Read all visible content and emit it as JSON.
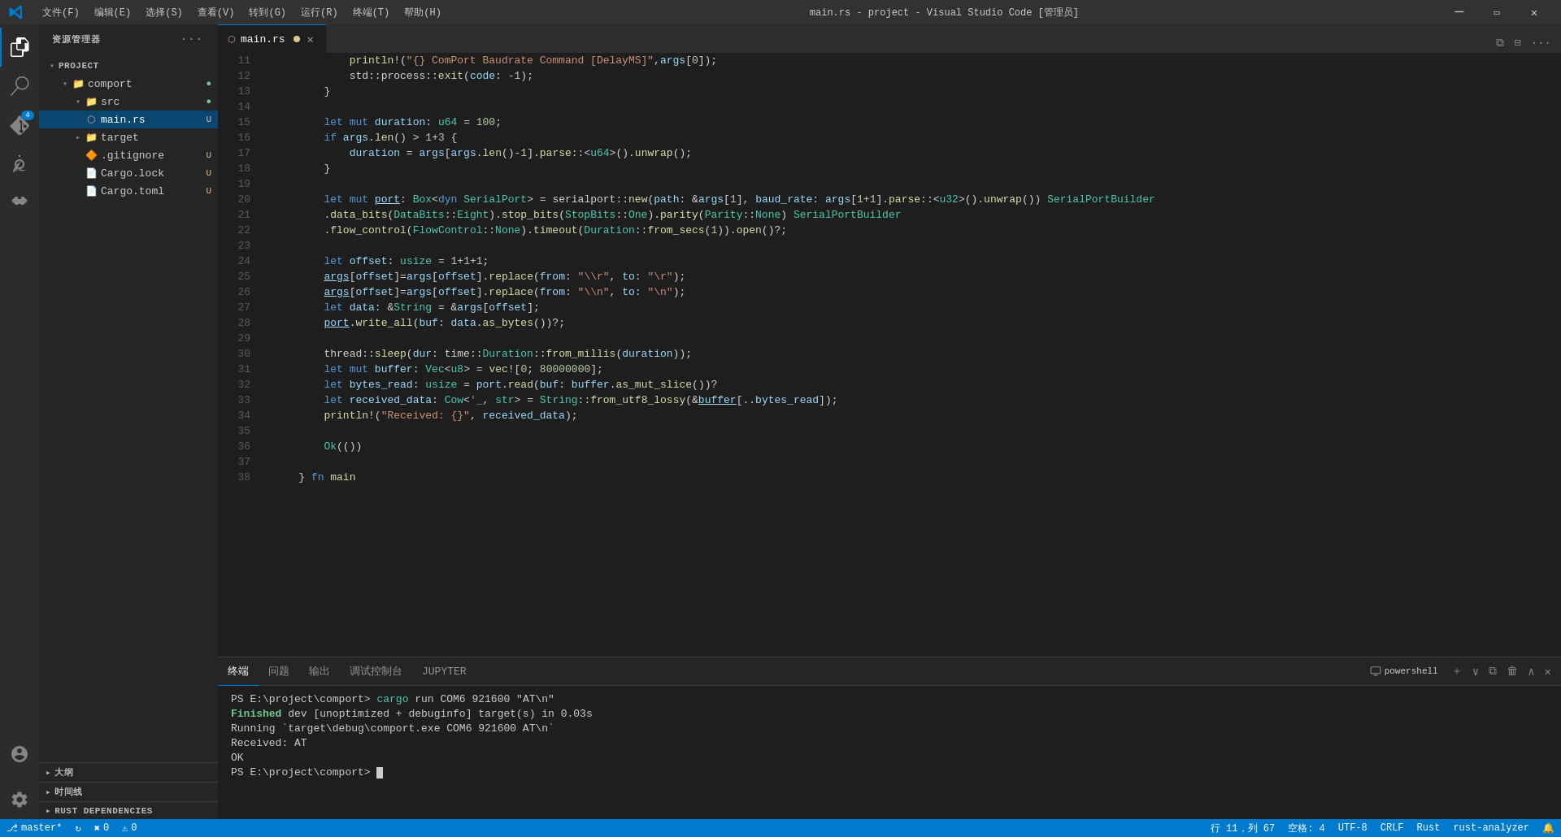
{
  "titleBar": {
    "title": "main.rs - project - Visual Studio Code [管理员]",
    "menu": [
      "文件(F)",
      "编辑(E)",
      "选择(S)",
      "查看(V)",
      "转到(G)",
      "运行(R)",
      "终端(T)",
      "帮助(H)"
    ],
    "controls": [
      "minimize",
      "maximize",
      "close"
    ]
  },
  "sidebar": {
    "title": "资源管理器",
    "sections": {
      "project": {
        "label": "PROJECT",
        "items": [
          {
            "id": "comport-folder",
            "label": "comport",
            "type": "folder",
            "indent": 1,
            "open": true,
            "badge": "●",
            "badgeType": "modified"
          },
          {
            "id": "src-folder",
            "label": "src",
            "type": "folder",
            "indent": 2,
            "open": true,
            "badge": "●",
            "badgeType": "modified"
          },
          {
            "id": "main-rs",
            "label": "main.rs",
            "type": "file-rust",
            "indent": 3,
            "badge": "U",
            "badgeType": "untracked"
          },
          {
            "id": "target-folder",
            "label": "target",
            "type": "folder",
            "indent": 2,
            "open": false
          },
          {
            "id": "gitignore",
            "label": ".gitignore",
            "type": "file-git",
            "indent": 2,
            "badge": "U",
            "badgeType": "untracked"
          },
          {
            "id": "cargo-lock",
            "label": "Cargo.lock",
            "type": "file",
            "indent": 2,
            "badge": "U",
            "badgeType": "untracked"
          },
          {
            "id": "cargo-toml",
            "label": "Cargo.toml",
            "type": "file",
            "indent": 2,
            "badge": "U",
            "badgeType": "untracked"
          }
        ]
      },
      "outline": {
        "label": "大纲"
      },
      "timeline": {
        "label": "时间线"
      },
      "rustDeps": {
        "label": "RUST DEPENDENCIES"
      }
    }
  },
  "tabs": [
    {
      "id": "main-rs",
      "label": "main.rs",
      "active": true,
      "modified": true,
      "icon": "rust"
    }
  ],
  "editor": {
    "lines": [
      {
        "num": 11,
        "code": "            println!(\"{{}} ComPort Baudrate Command [DelayMS]\",args[0]);"
      },
      {
        "num": 12,
        "code": "            std::process::exit(code: -1);"
      },
      {
        "num": 13,
        "code": "        }"
      },
      {
        "num": 14,
        "code": ""
      },
      {
        "num": 15,
        "code": "        let mut duration: u64 = 100;"
      },
      {
        "num": 16,
        "code": "        if args.len() > 1+3 {"
      },
      {
        "num": 17,
        "code": "            duration = args[args.len()-1].parse::<u64>().unwrap();"
      },
      {
        "num": 18,
        "code": "        }"
      },
      {
        "num": 19,
        "code": ""
      },
      {
        "num": 20,
        "code": "        let mut port: Box<dyn SerialPort> = serialport::new(path: &args[1], baud_rate: args[1+1].parse::<u32>().unwrap()) SerialPortBuilder"
      },
      {
        "num": 21,
        "code": "        .data_bits(DataBits::Eight).stop_bits(StopBits::One).parity(Parity::None) SerialPortBuilder"
      },
      {
        "num": 22,
        "code": "        .flow_control(FlowControl::None).timeout(Duration::from_secs(1)).open()?;"
      },
      {
        "num": 23,
        "code": ""
      },
      {
        "num": 24,
        "code": "        let offset: usize = 1+1+1;"
      },
      {
        "num": 25,
        "code": "        args[offset]=args[offset].replace(from: \"\\\\r\", to: \"\\r\");"
      },
      {
        "num": 26,
        "code": "        args[offset]=args[offset].replace(from: \"\\\\n\", to: \"\\n\");"
      },
      {
        "num": 27,
        "code": "        let data: &String = &args[offset];"
      },
      {
        "num": 28,
        "code": "        port.write_all(buf: data.as_bytes())?;"
      },
      {
        "num": 29,
        "code": ""
      },
      {
        "num": 30,
        "code": "        thread::sleep(dur: time::Duration::from_millis(duration));"
      },
      {
        "num": 31,
        "code": "        let mut buffer: Vec<u8> = vec![0; 80000000];"
      },
      {
        "num": 32,
        "code": "        let bytes_read: usize = port.read(buf: buffer.as_mut_slice())?"
      },
      {
        "num": 33,
        "code": "        let received_data: Cow<'_, str> = String::from_utf8_lossy(&buffer[..bytes_read]);"
      },
      {
        "num": 34,
        "code": "        println!(\"Received: {}\", received_data);"
      },
      {
        "num": 35,
        "code": ""
      },
      {
        "num": 36,
        "code": "        Ok(())"
      },
      {
        "num": 37,
        "code": ""
      },
      {
        "num": 38,
        "code": "    } fn main"
      }
    ]
  },
  "terminal": {
    "tabs": [
      {
        "id": "terminal",
        "label": "终端",
        "active": true
      },
      {
        "id": "problems",
        "label": "问题",
        "active": false
      },
      {
        "id": "output",
        "label": "输出",
        "active": false
      },
      {
        "id": "debug-console",
        "label": "调试控制台",
        "active": false
      },
      {
        "id": "jupyter",
        "label": "JUPYTER",
        "active": false
      }
    ],
    "shellLabel": "powershell",
    "lines": [
      {
        "type": "ps",
        "text": "PS E:\\project\\comport> cargo run COM6 921600 \"AT\\n\""
      },
      {
        "type": "finished",
        "text": "   Finished dev [unoptimized + debuginfo] target(s) in 0.03s"
      },
      {
        "type": "running",
        "text": "    Running `target\\debug\\comport.exe COM6 921600 AT\\n`"
      },
      {
        "type": "received",
        "text": "Received: AT"
      },
      {
        "type": "blank",
        "text": ""
      },
      {
        "type": "ok",
        "text": "OK"
      },
      {
        "type": "blank",
        "text": ""
      },
      {
        "type": "prompt",
        "text": "PS E:\\project\\comport> "
      }
    ]
  },
  "statusBar": {
    "left": [
      {
        "id": "git-branch",
        "icon": "⎇",
        "label": "master*"
      },
      {
        "id": "sync",
        "icon": "↻",
        "label": ""
      },
      {
        "id": "errors",
        "icon": "✖",
        "label": "0"
      },
      {
        "id": "warnings",
        "icon": "⚠",
        "label": "0"
      }
    ],
    "right": [
      {
        "id": "line-col",
        "label": "行 11，列 67"
      },
      {
        "id": "spaces",
        "label": "空格: 4"
      },
      {
        "id": "encoding",
        "label": "UTF-8"
      },
      {
        "id": "line-ending",
        "label": "CRLF"
      },
      {
        "id": "lang",
        "label": "Rust"
      },
      {
        "id": "rust-analyzer",
        "label": "rust-analyzer"
      },
      {
        "id": "notification",
        "label": "🔔"
      }
    ]
  }
}
